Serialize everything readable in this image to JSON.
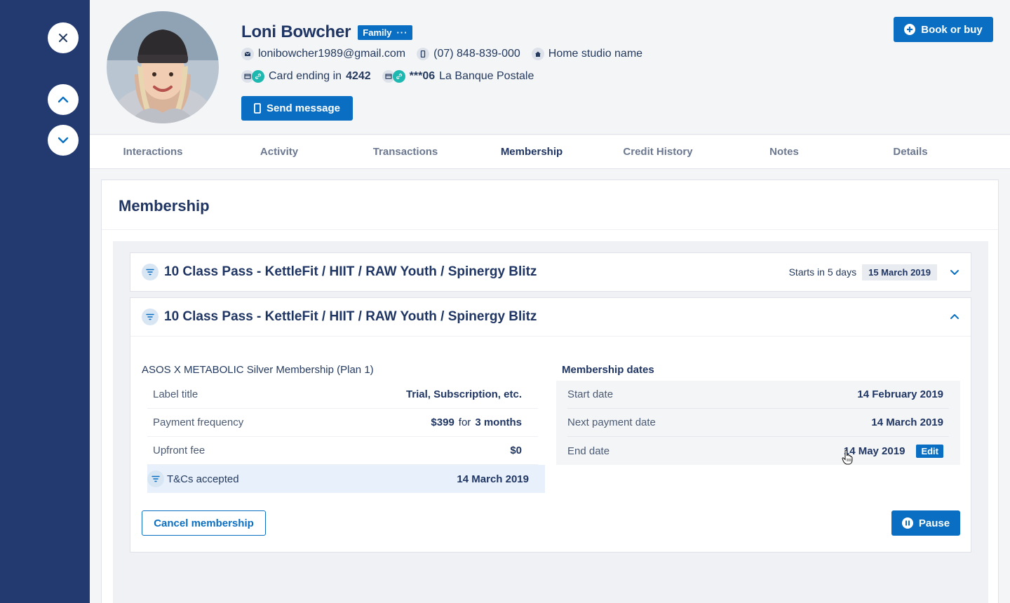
{
  "rail": {
    "close_icon": "close-icon",
    "up_icon": "chevron-up-icon",
    "down_icon": "chevron-down-icon"
  },
  "profile": {
    "name": "Loni Bowcher",
    "badge": "Family",
    "badge_more": "···",
    "email": "lonibowcher1989@gmail.com",
    "phone": "(07) 848-839-000",
    "studio": "Home studio name",
    "card_prefix": "Card ending in",
    "card_last4": "4242",
    "bank_masked": "***06",
    "bank_name": "La Banque Postale",
    "send_label": "Send message",
    "book_label": "Book or buy"
  },
  "tabs": [
    "Interactions",
    "Activity",
    "Transactions",
    "Membership",
    "Credit History",
    "Notes",
    "Details"
  ],
  "active_tab": "Membership",
  "panel": {
    "title": "Membership"
  },
  "cards": [
    {
      "title": "10 Class Pass - KettleFit / HIIT / RAW Youth / Spinergy Blitz",
      "starts_text": "Starts in 5 days",
      "start_date": "15 March  2019"
    },
    {
      "title": "10 Class Pass - KettleFit / HIIT / RAW Youth / Spinergy Blitz",
      "plan_name": "ASOS X METABOLIC Silver Membership (Plan 1)",
      "details": {
        "label_title_k": "Label title",
        "label_title_v": "Trial, Subscription, etc.",
        "payment_freq_k": "Payment frequency",
        "payment_amount": "$399",
        "payment_for": "for",
        "payment_period": "3 months",
        "upfront_k": "Upfront fee",
        "upfront_v": "$0",
        "tcs_k": "T&Cs accepted",
        "tcs_v": "14 March 2019"
      },
      "dates_title": "Membership dates",
      "dates": {
        "start_k": "Start date",
        "start_v": "14 February 2019",
        "next_k": "Next payment date",
        "next_v": "14 March 2019",
        "end_k": "End date",
        "end_v": "14 May 2019",
        "edit_label": "Edit"
      },
      "cancel_label": "Cancel membership",
      "pause_label": "Pause"
    }
  ],
  "colors": {
    "rail": "#233a70",
    "primary": "#0a6fc2",
    "text_dark": "#1f3563",
    "teal": "#1fb8b0"
  }
}
